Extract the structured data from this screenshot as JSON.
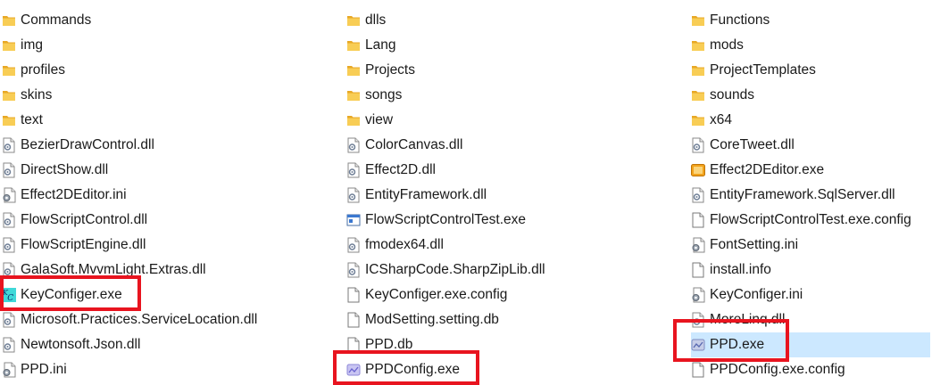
{
  "columns": [
    [
      {
        "name": "Commands",
        "icon": "folder-icon"
      },
      {
        "name": "img",
        "icon": "folder-icon"
      },
      {
        "name": "profiles",
        "icon": "folder-icon"
      },
      {
        "name": "skins",
        "icon": "folder-icon"
      },
      {
        "name": "text",
        "icon": "folder-icon"
      },
      {
        "name": "BezierDrawControl.dll",
        "icon": "dll-file-icon"
      },
      {
        "name": "DirectShow.dll",
        "icon": "dll-file-icon"
      },
      {
        "name": "Effect2DEditor.ini",
        "icon": "ini-settings-icon"
      },
      {
        "name": "FlowScriptControl.dll",
        "icon": "dll-file-icon"
      },
      {
        "name": "FlowScriptEngine.dll",
        "icon": "dll-file-icon"
      },
      {
        "name": "GalaSoft.MvvmLight.Extras.dll",
        "icon": "dll-file-icon"
      },
      {
        "name": "KeyConfiger.exe",
        "icon": "keyconfiger-app-icon",
        "highlighted": true
      },
      {
        "name": "Microsoft.Practices.ServiceLocation.dll",
        "icon": "dll-file-icon"
      },
      {
        "name": "Newtonsoft.Json.dll",
        "icon": "dll-file-icon"
      },
      {
        "name": "PPD.ini",
        "icon": "ini-settings-icon"
      }
    ],
    [
      {
        "name": "dlls",
        "icon": "folder-icon"
      },
      {
        "name": "Lang",
        "icon": "folder-icon"
      },
      {
        "name": "Projects",
        "icon": "folder-icon"
      },
      {
        "name": "songs",
        "icon": "folder-icon"
      },
      {
        "name": "view",
        "icon": "folder-icon"
      },
      {
        "name": "ColorCanvas.dll",
        "icon": "dll-file-icon"
      },
      {
        "name": "Effect2D.dll",
        "icon": "dll-file-icon"
      },
      {
        "name": "EntityFramework.dll",
        "icon": "dll-file-icon"
      },
      {
        "name": "FlowScriptControlTest.exe",
        "icon": "window-app-icon"
      },
      {
        "name": "fmodex64.dll",
        "icon": "dll-file-icon"
      },
      {
        "name": "ICSharpCode.SharpZipLib.dll",
        "icon": "dll-file-icon"
      },
      {
        "name": "KeyConfiger.exe.config",
        "icon": "blank-file-icon"
      },
      {
        "name": "ModSetting.setting.db",
        "icon": "blank-file-icon"
      },
      {
        "name": "PPD.db",
        "icon": "blank-file-icon"
      },
      {
        "name": "PPDConfig.exe",
        "icon": "ppdconfig-app-icon",
        "highlighted": true
      }
    ],
    [
      {
        "name": "Functions",
        "icon": "folder-icon"
      },
      {
        "name": "mods",
        "icon": "folder-icon"
      },
      {
        "name": "ProjectTemplates",
        "icon": "folder-icon"
      },
      {
        "name": "sounds",
        "icon": "folder-icon"
      },
      {
        "name": "x64",
        "icon": "folder-icon"
      },
      {
        "name": "CoreTweet.dll",
        "icon": "dll-file-icon"
      },
      {
        "name": "Effect2DEditor.exe",
        "icon": "effect2deditor-app-icon"
      },
      {
        "name": "EntityFramework.SqlServer.dll",
        "icon": "dll-file-icon"
      },
      {
        "name": "FlowScriptControlTest.exe.config",
        "icon": "blank-file-icon"
      },
      {
        "name": "FontSetting.ini",
        "icon": "ini-settings-icon"
      },
      {
        "name": "install.info",
        "icon": "blank-file-icon"
      },
      {
        "name": "KeyConfiger.ini",
        "icon": "ini-settings-icon"
      },
      {
        "name": "MoreLinq.dll",
        "icon": "dll-file-icon"
      },
      {
        "name": "PPD.exe",
        "icon": "ppd-app-icon",
        "selected": true,
        "highlighted": true
      },
      {
        "name": "PPDConfig.exe.config",
        "icon": "blank-file-icon"
      }
    ]
  ],
  "colors": {
    "folder": "#f5c242",
    "selection": "#cce8ff",
    "highlight_box": "#e8141f"
  }
}
